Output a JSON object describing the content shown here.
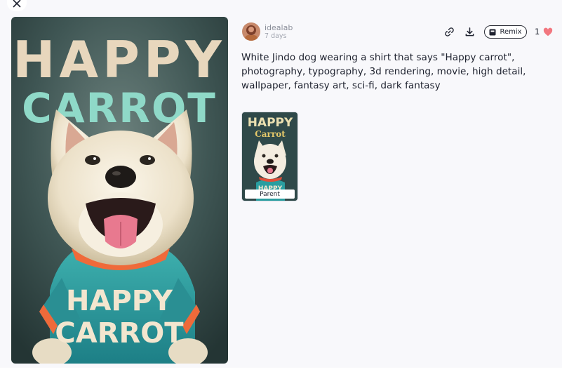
{
  "post": {
    "author": "idealab",
    "time_ago": "7 days",
    "prompt": "White Jindo dog wearing a shirt that says \"Happy carrot\", photography, typography, 3d rendering, movie, high detail, wallpaper, fantasy art, sci-fi, dark fantasy",
    "like_count": "1"
  },
  "actions": {
    "close_icon": "close-icon",
    "copy_link_icon": "link-icon",
    "download_icon": "download-icon",
    "remix_label": "Remix",
    "remix_icon": "remix-icon",
    "like_icon": "heart-icon"
  },
  "artwork": {
    "poster_line1": "HAPPY",
    "poster_line2": "CARROT",
    "shirt_line1": "HAPPY",
    "shirt_line2": "CARROT"
  },
  "parent": {
    "label": "Parent",
    "thumb_line1": "HAPPY",
    "thumb_line2": "Carrot",
    "thumb_shirt": "HAPPY"
  },
  "colors": {
    "heart": "#f2777f",
    "panel_bg": "#f8f8fb"
  }
}
